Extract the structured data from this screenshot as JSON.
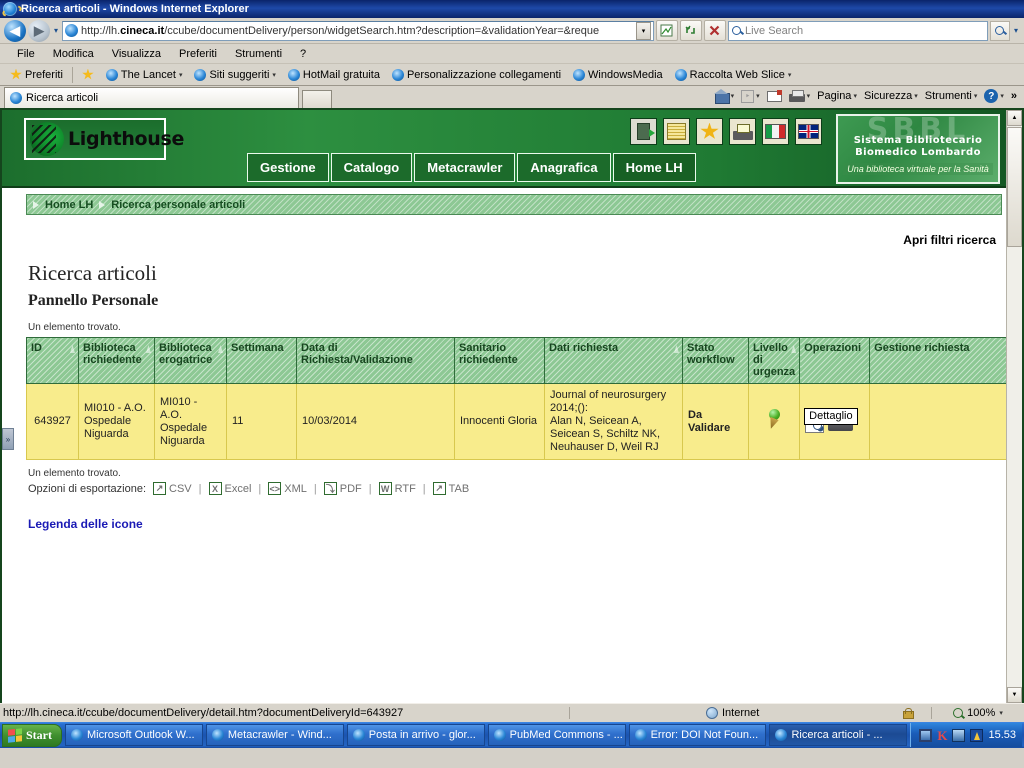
{
  "window": {
    "title": "Ricerca articoli - Windows Internet Explorer",
    "ie_icon": "ie-logo-icon"
  },
  "navbar": {
    "back_label": "◀",
    "forward_label": "▶",
    "history_caret": "▾",
    "url_prefix": "http://lh.",
    "url_domain": "cineca.it",
    "url_suffix": "/ccube/documentDelivery/person/widgetSearch.htm?description=&validationYear=&reque",
    "url_full": "http://lh.cineca.it/ccube/documentDelivery/person/widgetSearch.htm?description=&validationYear=&reque",
    "dropdown_caret": "▾",
    "search_placeholder": "Live Search",
    "search_value": "",
    "go_caret": "▾",
    "buttons": [
      {
        "name": "compatibility-view-icon",
        "glyph": "⬚"
      },
      {
        "name": "refresh-icon",
        "glyph": "↻"
      },
      {
        "name": "stop-icon",
        "glyph": "✕"
      }
    ]
  },
  "menubar": {
    "items": [
      "File",
      "Modifica",
      "Visualizza",
      "Preferiti",
      "Strumenti",
      "?"
    ]
  },
  "favbar": {
    "favorites_label": "Preferiti",
    "items": [
      {
        "label": "The Lancet",
        "has_caret": true
      },
      {
        "label": "Siti suggeriti",
        "has_caret": true
      },
      {
        "label": "HotMail gratuita",
        "has_caret": false
      },
      {
        "label": "Personalizzazione collegamenti",
        "has_caret": false
      },
      {
        "label": "WindowsMedia",
        "has_caret": false
      },
      {
        "label": "Raccolta Web Slice",
        "has_caret": true
      }
    ]
  },
  "tabbar": {
    "tabs": [
      {
        "label": "Ricerca articoli"
      }
    ],
    "new_tab_label": ""
  },
  "commandbar": {
    "home_label": "",
    "page_label": "Pagina",
    "security_label": "Sicurezza",
    "tools_label": "Strumenti",
    "help_label": "",
    "overflow_label": "»",
    "caret": "▾"
  },
  "site": {
    "logo_text": "Lighthouse",
    "header_icons": [
      {
        "name": "logout-icon"
      },
      {
        "name": "notes-icon"
      },
      {
        "name": "favorites-star-icon"
      },
      {
        "name": "print-icon"
      },
      {
        "name": "flag-italy-icon"
      },
      {
        "name": "flag-uk-icon"
      }
    ],
    "sbbl": {
      "ghost": "SBBL",
      "line1": "Sistema Bibliotecario",
      "line2": "Biomedico Lombardo",
      "tagline": "Una biblioteca virtuale per la Sanità"
    },
    "nav": [
      {
        "label": "Gestione"
      },
      {
        "label": "Catalogo"
      },
      {
        "label": "Metacrawler"
      },
      {
        "label": "Anagrafica"
      },
      {
        "label": "Home LH",
        "active": true
      }
    ]
  },
  "breadcrumb": {
    "items": [
      "Home LH",
      "Ricerca personale articoli"
    ]
  },
  "main": {
    "filters_link": "Apri filtri ricerca",
    "page_title": "Ricerca articoli",
    "page_subtitle": "Pannello Personale",
    "found_top": "Un elemento trovato.",
    "found_bottom": "Un elemento trovato.",
    "export_label": "Opzioni di esportazione:",
    "export_options": [
      {
        "label": "CSV",
        "icon_glyph": "↗"
      },
      {
        "label": "Excel",
        "icon_glyph": "X"
      },
      {
        "label": "XML",
        "icon_glyph": "<>"
      },
      {
        "label": "PDF",
        "icon_glyph": "⤵"
      },
      {
        "label": "RTF",
        "icon_glyph": "W"
      },
      {
        "label": "TAB",
        "icon_glyph": "↗"
      }
    ],
    "legend_link": "Legenda delle icone"
  },
  "table": {
    "headers": [
      "ID",
      "Biblioteca richiedente",
      "Biblioteca erogatrice",
      "Settimana",
      "Data di Richiesta/Validazione",
      "Sanitario richiedente",
      "Dati richiesta",
      "Stato workflow",
      "Livello di urgenza",
      "Operazioni",
      "Gestione richiesta"
    ],
    "rows": [
      {
        "id": "643927",
        "biblioteca_richiedente": "MI010 - A.O. Ospedale Niguarda",
        "biblioteca_erogatrice": "MI010 - A.O. Ospedale Niguarda",
        "settimana": "11",
        "data_richiesta": "10/03/2014",
        "sanitario_richiedente": "Innocenti Gloria",
        "dati_richiesta": "Journal of neurosurgery 2014;():\nAlan N, Seicean A, Seicean S, Schiltz NK, Neuhauser D, Weil RJ",
        "stato_workflow": "Da Validare",
        "livello_urgenza": "",
        "operazioni_tooltip": "Dettaglio",
        "gestione_richiesta": ""
      }
    ]
  },
  "statusbar": {
    "url": "http://lh.cineca.it/ccube/documentDelivery/detail.htm?documentDeliveryId=643927",
    "zone": "Internet",
    "zoom": "100%",
    "zoom_caret": "▾"
  },
  "taskbar": {
    "start_label": "Start",
    "items": [
      {
        "label": "Microsoft Outlook W...",
        "active": false
      },
      {
        "label": "Metacrawler - Wind...",
        "active": false
      },
      {
        "label": "Posta in arrivo - glor...",
        "active": false
      },
      {
        "label": "PubMed Commons - ...",
        "active": false
      },
      {
        "label": "Error: DOI Not Foun...",
        "active": false
      },
      {
        "label": "Ricerca articoli - ...",
        "active": true
      }
    ],
    "clock": "15.53"
  },
  "colors": {
    "brand_green": "#1f7a33",
    "table_header": "#8dc894",
    "table_row": "#f8ec8c",
    "title_bar": "#0a246a",
    "link_blue": "#1a1ab5"
  }
}
